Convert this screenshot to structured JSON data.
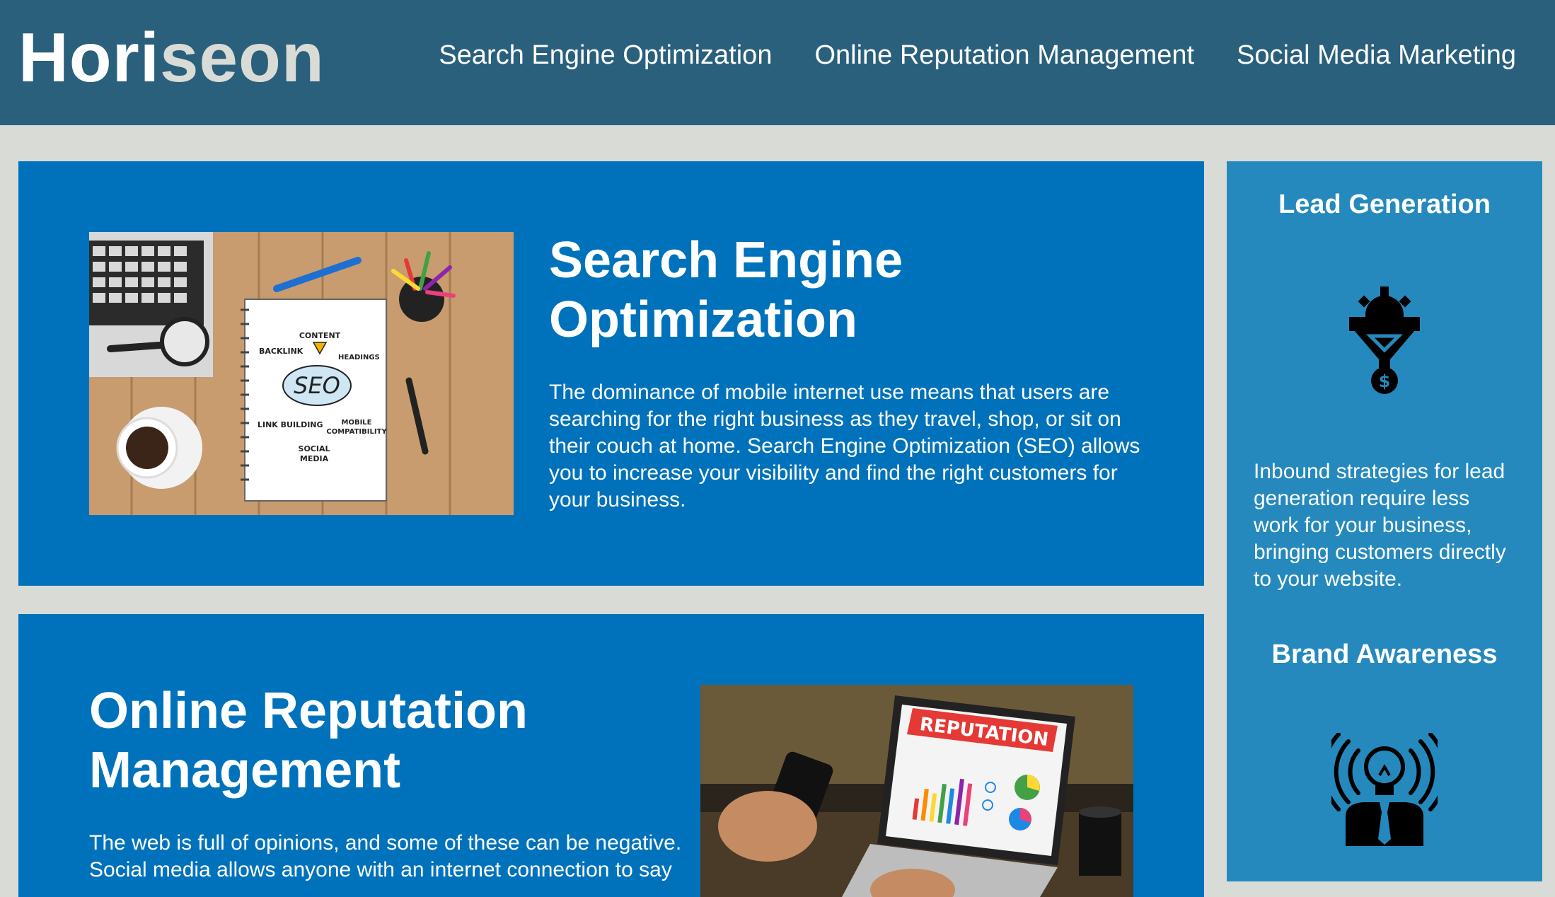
{
  "header": {
    "brand_part1": "Hori",
    "brand_part2": "seon",
    "nav": [
      "Search Engine Optimization",
      "Online Reputation Management",
      "Social Media Marketing"
    ]
  },
  "sections": [
    {
      "title": "Search Engine Optimization",
      "body": "The dominance of mobile internet use means that users are searching for the right business as they travel, shop, or sit on their couch at home. Search Engine Optimization (SEO) allows you to increase your visibility and find the right customers for your business.",
      "image_words": [
        "CONTENT",
        "BACKLINK",
        "HEADINGS",
        "SEO",
        "LINK BUILDING",
        "MOBILE",
        "COMPATIBILITY",
        "SOCIAL",
        "MEDIA"
      ]
    },
    {
      "title": "Online Reputation Management",
      "body": "The web is full of opinions, and some of these can be negative. Social media allows anyone with an internet connection to say",
      "image_word": "REPUTATION"
    }
  ],
  "aside": {
    "lead_title": "Lead Generation",
    "lead_text": "Inbound strategies for lead generation require less work for your business, bringing customers directly to your website.",
    "brand_title": "Brand Awareness"
  },
  "colors": {
    "header_bg": "#2a607c",
    "page_bg": "#d9dcd6",
    "card_bg": "#0072bb",
    "aside_bg": "#2589bd",
    "brand_accent": "#d9dcd6"
  },
  "icons": [
    "lead-generation-funnel-icon",
    "brand-awareness-bulb-icon"
  ]
}
